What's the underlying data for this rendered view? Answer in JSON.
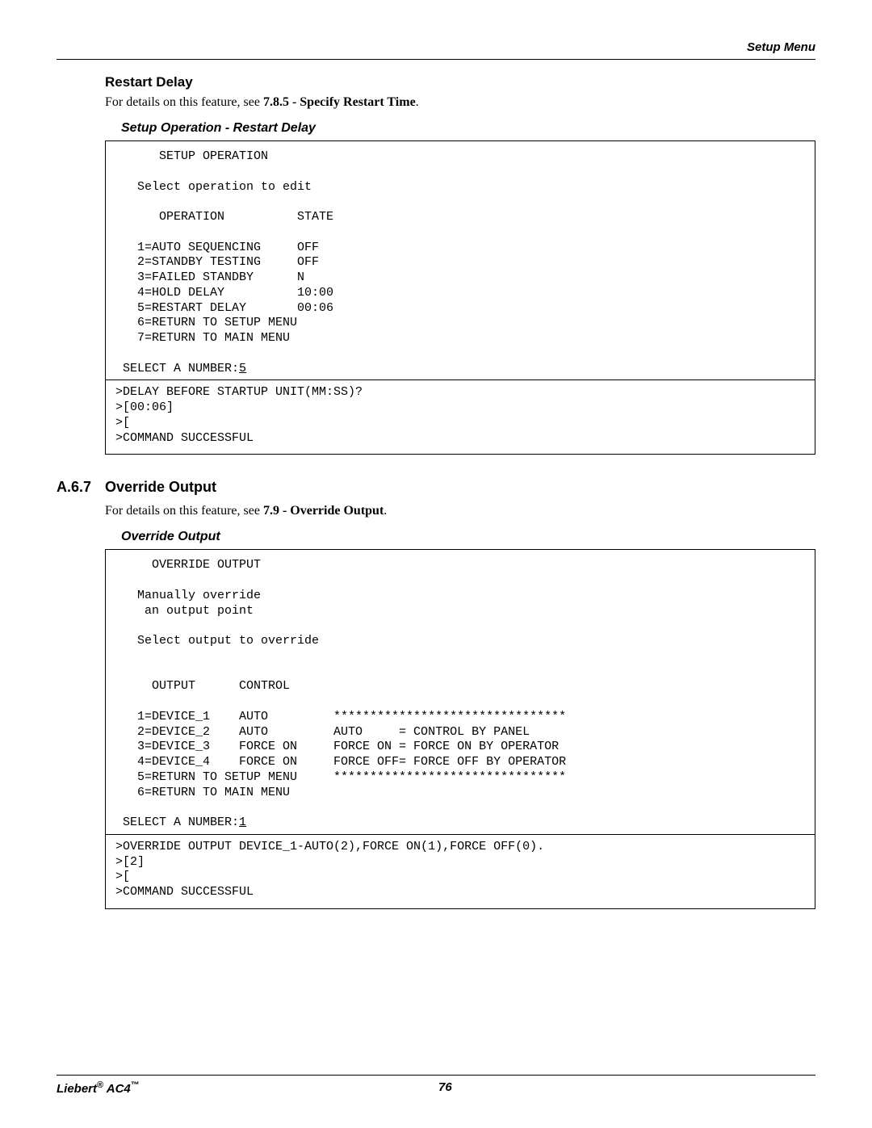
{
  "header": {
    "right": "Setup Menu"
  },
  "restart": {
    "title": "Restart Delay",
    "intro_pre": "For details on this feature, see ",
    "intro_ref": "7.8.5 - Specify Restart Time",
    "intro_post": ".",
    "caption": "Setup Operation - Restart Delay",
    "terminal": {
      "l0": "      SETUP OPERATION",
      "l1": "",
      "l2": "   Select operation to edit",
      "l3": "",
      "l4": "      OPERATION          STATE",
      "l5": "",
      "l6": "   1=AUTO SEQUENCING     OFF",
      "l7": "   2=STANDBY TESTING     OFF",
      "l8": "   3=FAILED STANDBY      N",
      "l9": "   4=HOLD DELAY          10:00",
      "l10": "   5=RESTART DELAY       00:06",
      "l11": "   6=RETURN TO SETUP MENU",
      "l12": "   7=RETURN TO MAIN MENU",
      "l13": "",
      "l14a": " SELECT A NUMBER:",
      "l14b": "5",
      "l15": ">DELAY BEFORE STARTUP UNIT(MM:SS)?",
      "l16": ">[00:06]",
      "l17": ">[",
      "l18": ">COMMAND SUCCESSFUL"
    }
  },
  "override": {
    "sec_num": "A.6.7",
    "sec_title": "Override Output",
    "intro_pre": "For details on this feature, see ",
    "intro_ref": "7.9 - Override Output",
    "intro_post": ".",
    "caption": "Override Output",
    "terminal": {
      "l0": "     OVERRIDE OUTPUT",
      "l1": "",
      "l2": "   Manually override",
      "l3": "    an output point",
      "l4": "",
      "l5": "   Select output to override",
      "l6": "",
      "l7": "",
      "l8": "     OUTPUT      CONTROL",
      "l9": "",
      "l10": "   1=DEVICE_1    AUTO         ********************************",
      "l11": "   2=DEVICE_2    AUTO         AUTO     = CONTROL BY PANEL",
      "l12": "   3=DEVICE_3    FORCE ON     FORCE ON = FORCE ON BY OPERATOR",
      "l13": "   4=DEVICE_4    FORCE ON     FORCE OFF= FORCE OFF BY OPERATOR",
      "l14": "   5=RETURN TO SETUP MENU     ********************************",
      "l15": "   6=RETURN TO MAIN MENU",
      "l16": "",
      "l17a": " SELECT A NUMBER:",
      "l17b": "1",
      "l18": ">OVERRIDE OUTPUT DEVICE_1-AUTO(2),FORCE ON(1),FORCE OFF(0).",
      "l19": ">[2]",
      "l20": ">[",
      "l21": ">COMMAND SUCCESSFUL"
    }
  },
  "footer": {
    "product_a": "Liebert",
    "reg": "®",
    "product_b": " AC4",
    "tm": "™",
    "page": "76"
  }
}
